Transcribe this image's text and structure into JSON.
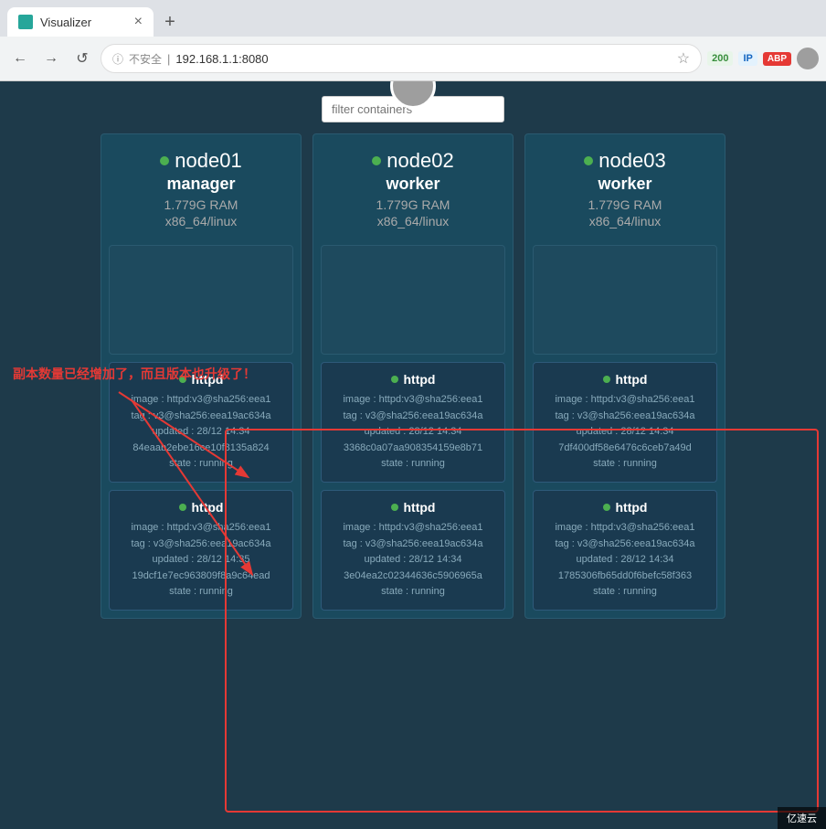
{
  "browser": {
    "tab_title": "Visualizer",
    "new_tab_label": "+",
    "close_tab_label": "×",
    "back_label": "←",
    "forward_label": "→",
    "reload_label": "↺",
    "not_secure_label": "不安全",
    "address": "192.168.1.1:8080",
    "star_label": "☆",
    "badge_200": "200",
    "badge_ip": "IP",
    "badge_abp": "ABP"
  },
  "app": {
    "filter_placeholder": "filter containers"
  },
  "nodes": [
    {
      "name": "node01",
      "role": "manager",
      "ram": "1.779G RAM",
      "arch": "x86_64/linux",
      "status": "online"
    },
    {
      "name": "node02",
      "role": "worker",
      "ram": "1.779G RAM",
      "arch": "x86_64/linux",
      "status": "online"
    },
    {
      "name": "node03",
      "role": "worker",
      "ram": "1.779G RAM",
      "arch": "x86_64/linux",
      "status": "online"
    }
  ],
  "containers": [
    [
      {
        "name": "httpd",
        "image": "image : httpd:v3@sha256:eea1",
        "tag": "tag : v3@sha256:eea19ac634a",
        "updated": "updated : 28/12 14:34",
        "id": "84eaab2ebe16ce10f8135a824",
        "state": "state : running"
      },
      {
        "name": "httpd",
        "image": "image : httpd:v3@sha256:eea1",
        "tag": "tag : v3@sha256:eea19ac634a",
        "updated": "updated : 28/12 14:35",
        "id": "19dcf1e7ec963809f8a9c64ead",
        "state": "state : running"
      }
    ],
    [
      {
        "name": "httpd",
        "image": "image : httpd:v3@sha256:eea1",
        "tag": "tag : v3@sha256:eea19ac634a",
        "updated": "updated : 28/12 14:34",
        "id": "3368c0a07aa908354159e8b71",
        "state": "state : running"
      },
      {
        "name": "httpd",
        "image": "image : httpd:v3@sha256:eea1",
        "tag": "tag : v3@sha256:eea19ac634a",
        "updated": "updated : 28/12 14:34",
        "id": "3e04ea2c02344636c5906965a",
        "state": "state : running"
      }
    ],
    [
      {
        "name": "httpd",
        "image": "image : httpd:v3@sha256:eea1",
        "tag": "tag : v3@sha256:eea19ac634a",
        "updated": "updated : 28/12 14:34",
        "id": "7df400df58e6476c6ceb7a49d",
        "state": "state : running"
      },
      {
        "name": "httpd",
        "image": "image : httpd:v3@sha256:eea1",
        "tag": "tag : v3@sha256:eea19ac634a",
        "updated": "updated : 28/12 14:34",
        "id": "1785306fb65dd0f6befc58f363",
        "state": "state : running"
      }
    ]
  ],
  "annotation": {
    "text": "副本数量已经增加了，而且版本也升级了！"
  },
  "watermark": {
    "text": "亿速云"
  }
}
